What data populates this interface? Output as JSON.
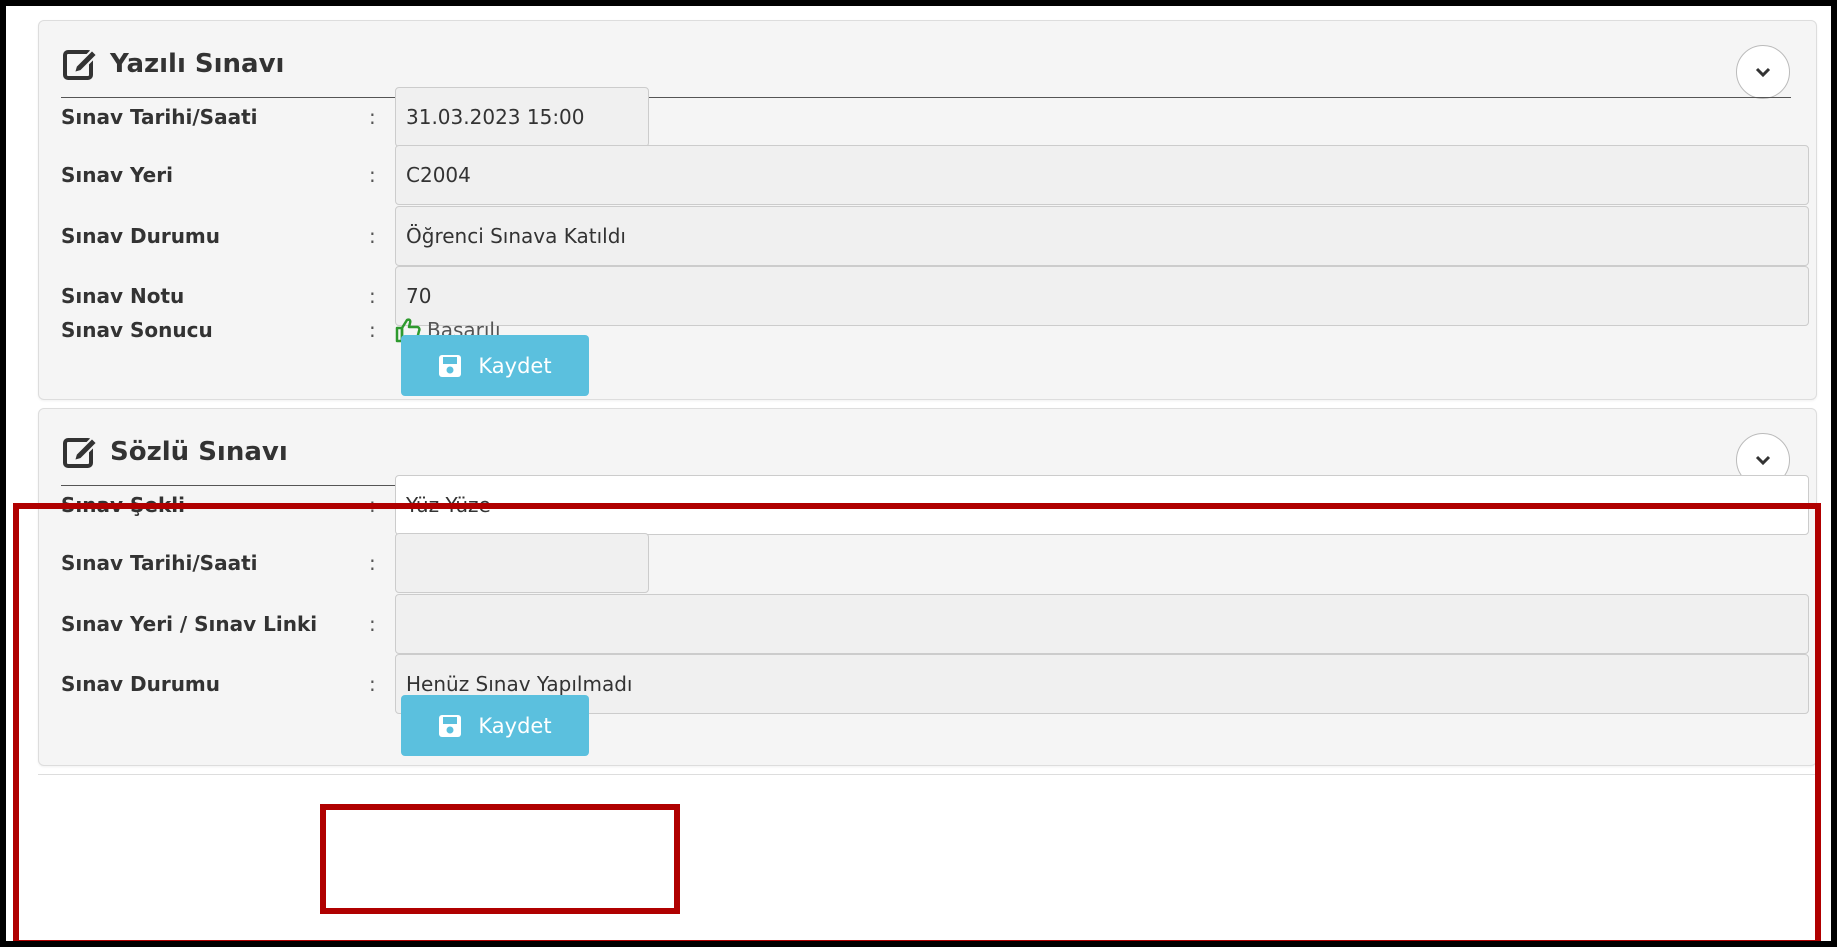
{
  "yazili": {
    "title": "Yazılı Sınavı",
    "colon": ":",
    "rows": {
      "tarih": {
        "label": "Sınav Tarihi/Saati",
        "value": "31.03.2023 15:00"
      },
      "yer": {
        "label": "Sınav Yeri",
        "value": "C2004"
      },
      "durum": {
        "label": "Sınav Durumu",
        "value": "Öğrenci Sınava Katıldı"
      },
      "notu": {
        "label": "Sınav Notu",
        "value": "70"
      },
      "sonuc": {
        "label": "Sınav Sonucu",
        "value": "Başarılı"
      }
    },
    "save_label": "Kaydet"
  },
  "sozlu": {
    "title": "Sözlü Sınavı",
    "colon": ":",
    "rows": {
      "sekli": {
        "label": "Sınav Şekli",
        "value": "Yüz Yüze"
      },
      "tarih": {
        "label": "Sınav Tarihi/Saati",
        "value": ""
      },
      "yer_link": {
        "label": "Sınav Yeri / Sınav Linki",
        "value": ""
      },
      "durum": {
        "label": "Sınav Durumu",
        "value": "Henüz Sınav Yapılmadı"
      }
    },
    "save_label": "Kaydet"
  },
  "icons": {
    "title_icon": "edit-icon",
    "collapse_icon": "chevron-down-icon",
    "result_icon": "thumbs-up-icon",
    "save_icon": "floppy-disk-icon"
  },
  "colors": {
    "button": "#5bc0de",
    "highlight": "#b00000",
    "success": "#2e9a2e"
  }
}
